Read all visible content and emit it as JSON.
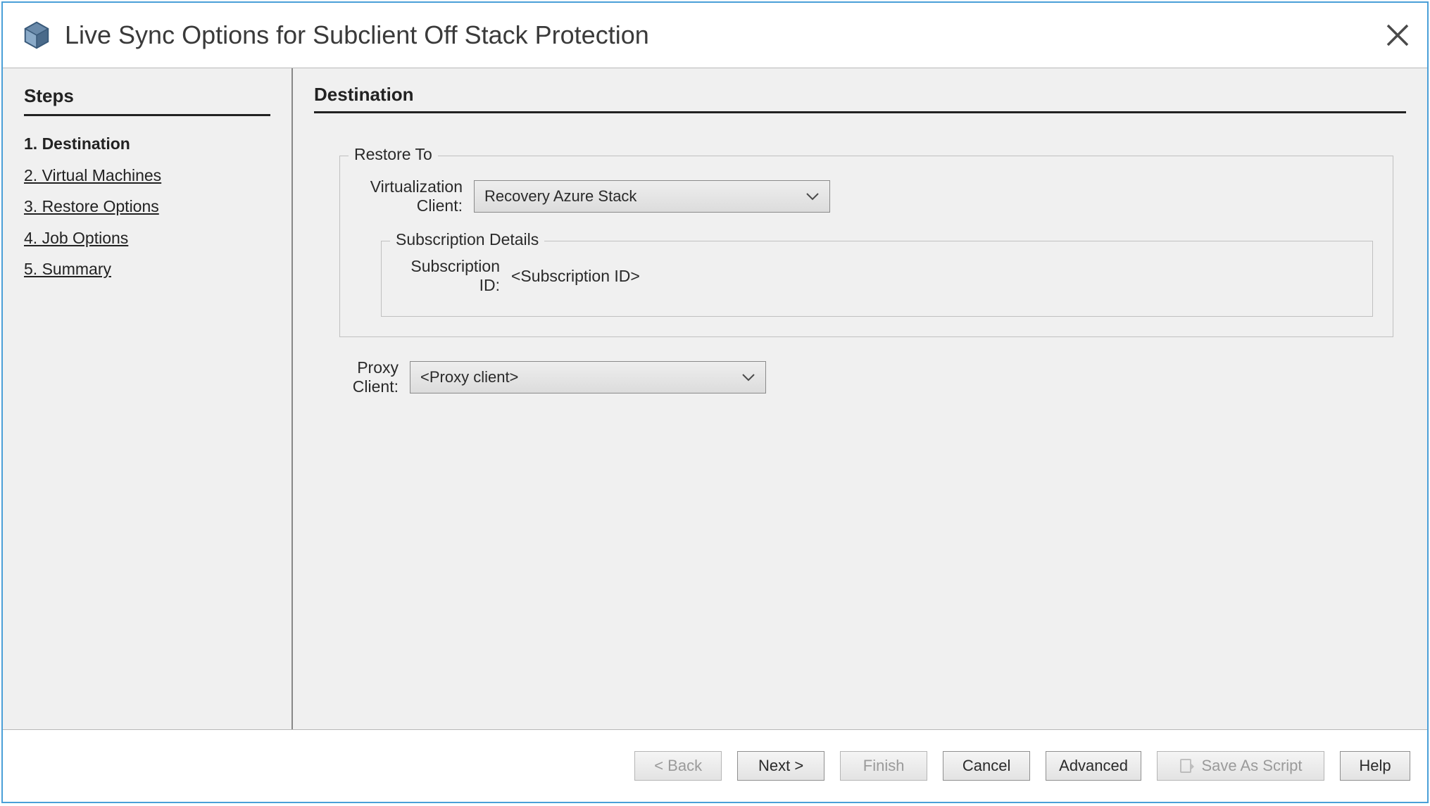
{
  "window": {
    "title": "Live Sync Options for Subclient Off Stack Protection"
  },
  "sidebar": {
    "heading": "Steps",
    "items": [
      {
        "label": "1. Destination",
        "current": true
      },
      {
        "label": "2. Virtual Machines",
        "current": false
      },
      {
        "label": "3. Restore Options",
        "current": false
      },
      {
        "label": "4. Job Options",
        "current": false
      },
      {
        "label": "5. Summary",
        "current": false
      }
    ]
  },
  "page": {
    "heading": "Destination",
    "restore_to": {
      "legend": "Restore To",
      "virt_client_label": "Virtualization Client:",
      "virt_client_value": "Recovery Azure Stack",
      "subscription": {
        "legend": "Subscription Details",
        "id_label": "Subscription ID:",
        "id_value": "<Subscription ID>"
      }
    },
    "proxy": {
      "label": "Proxy Client:",
      "value": "<Proxy client>"
    }
  },
  "footer": {
    "back": "< Back",
    "next": "Next >",
    "finish": "Finish",
    "cancel": "Cancel",
    "advanced": "Advanced",
    "save_script": "Save As Script",
    "help": "Help"
  }
}
